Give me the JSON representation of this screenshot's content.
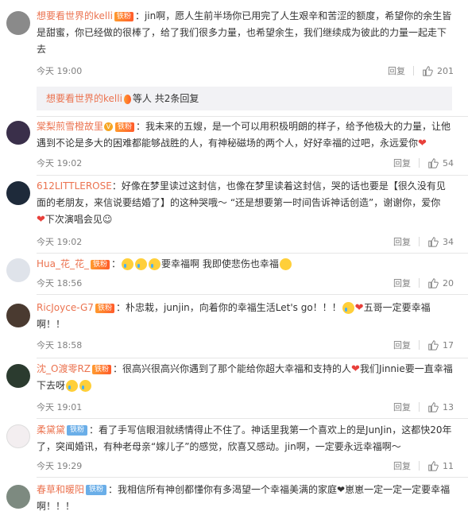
{
  "comments": [
    {
      "name": "想要看世界的kelli",
      "badge": "铁粉",
      "text": "：jin啊，愿人生前半场你已用完了人生艰辛和苦涩的额度，希望你的余生皆是甜蜜，你已经做的很棒了，给了我们很多力量，也希望余生，我们继续成为彼此的力量一起走下去",
      "time": "今天 19:00",
      "reply": "回复",
      "likes": "201"
    },
    {
      "name": "棠梨煎雪橙故里",
      "badge": "铁粉",
      "text": "：我未来的五嫂，是一个可以用积极明朗的样子，给予他极大的力量，让他遇到不论是多大的困难都能够战胜的人，有神秘磁场的两个人，好好幸福的过吧，永远爱你",
      "time": "今天 19:02",
      "reply": "回复",
      "likes": "54"
    },
    {
      "name": "612LITTLEROSE",
      "text": "：好像在梦里读过这封信，也像在梦里读着这封信，哭的话也要是【很久没有见面的老朋友，来信说要结婚了】的这种哭哦～ “还是想要第一时间告诉神话创造”，谢谢你，爱你",
      "text2": "下次演唱会见",
      "time": "今天 19:02",
      "reply": "回复",
      "likes": "34"
    },
    {
      "name": "Hua_花_花_",
      "badge": "铁粉",
      "text": "要幸福啊 我即使悲伤也幸福",
      "time": "今天 18:56",
      "reply": "回复",
      "likes": "20"
    },
    {
      "name": "RicJoyce-G7",
      "badge": "铁粉",
      "text": "：朴忠栽，junjin，向着你的幸福生活Let's go！！！",
      "text2": "五哥一定要幸福啊！！",
      "time": "今天 18:58",
      "reply": "回复",
      "likes": "17"
    },
    {
      "name": "沈_O渡零RZ",
      "badge": "铁粉",
      "text": "：很高兴很高兴你遇到了那个能给你超大幸福和支持的人",
      "text2": "我们Jinnie要一直幸福下去呀",
      "time": "今天 19:01",
      "reply": "回复",
      "likes": "13"
    },
    {
      "name": "柔黛黛",
      "badge": "铁粉",
      "text": "：看了手写信眼泪就绣情得止不住了。神话里我第一个喜欢上的是JunJin，这都快20年了，突闻婚讯，有种老母亲“嫁儿子”的感觉，欣喜又感动。jin啊，一定要永远幸福啊～",
      "time": "今天 19:29",
      "reply": "回复",
      "likes": "11"
    },
    {
      "name": "春草和暖阳",
      "badge": "铁粉",
      "text": "：我相信所有神创都懂你有多渴望一个幸福美满的家庭",
      "text2": "崽崽一定一定一定要幸福啊！！！"
    }
  ],
  "subreply": {
    "name": "想要看世界的kelli",
    "text": "等人 共2条回复"
  },
  "colors": {
    "accent": "#eb7350",
    "meta": "#808080",
    "divider": "#e6e6e6"
  }
}
